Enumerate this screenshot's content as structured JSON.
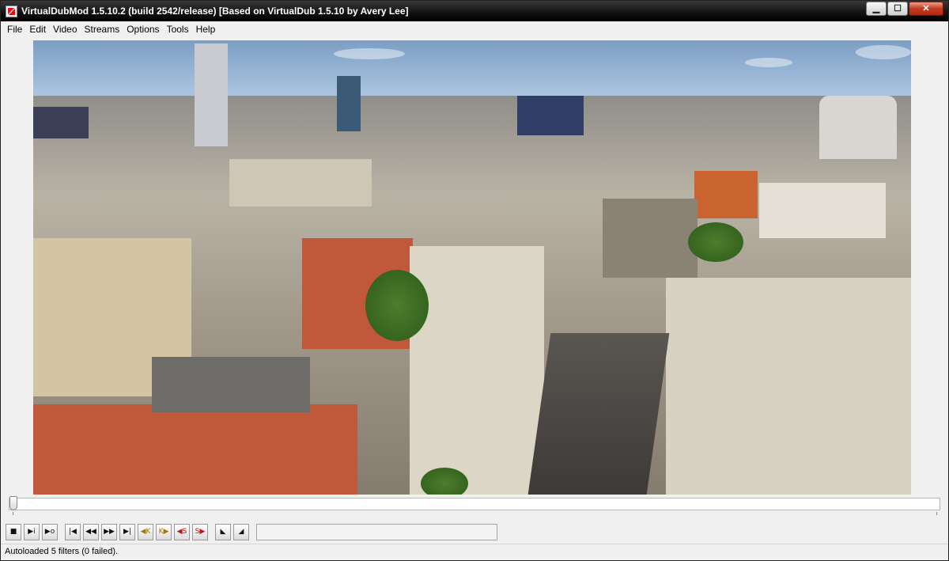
{
  "window": {
    "title": "VirtualDubMod 1.5.10.2 (build 2542/release) [Based on VirtualDub 1.5.10 by Avery Lee]",
    "controls": {
      "minimize": "▁",
      "maximize": "☐",
      "close": "✕"
    }
  },
  "menubar": {
    "items": [
      "File",
      "Edit",
      "Video",
      "Streams",
      "Options",
      "Tools",
      "Help"
    ]
  },
  "video": {
    "description_icon": "video-frame",
    "colors": {
      "sky": "#a8c2de",
      "brick": "#c0583a",
      "stone": "#d8d2c2"
    }
  },
  "seek": {
    "position_fraction": 0.0
  },
  "toolbar": {
    "buttons": [
      {
        "icon": "stop-icon",
        "glyph": "■"
      },
      {
        "icon": "play-input-icon",
        "glyph": "▶i"
      },
      {
        "icon": "play-output-icon",
        "glyph": "▶o"
      },
      {
        "icon": "go-start-icon",
        "glyph": "|◀"
      },
      {
        "icon": "step-back-icon",
        "glyph": "◀◀"
      },
      {
        "icon": "step-forward-icon",
        "glyph": "▶▶"
      },
      {
        "icon": "go-end-icon",
        "glyph": "▶|"
      },
      {
        "icon": "prev-keyframe-icon",
        "glyph": "◀K"
      },
      {
        "icon": "next-keyframe-icon",
        "glyph": "K▶"
      },
      {
        "icon": "prev-scene-icon",
        "glyph": "◀S"
      },
      {
        "icon": "next-scene-icon",
        "glyph": "S▶"
      },
      {
        "icon": "mark-in-icon",
        "glyph": "◣"
      },
      {
        "icon": "mark-out-icon",
        "glyph": "◢"
      }
    ],
    "frame_field_value": ""
  },
  "status": {
    "text": "Autoloaded 5 filters (0 failed)."
  }
}
